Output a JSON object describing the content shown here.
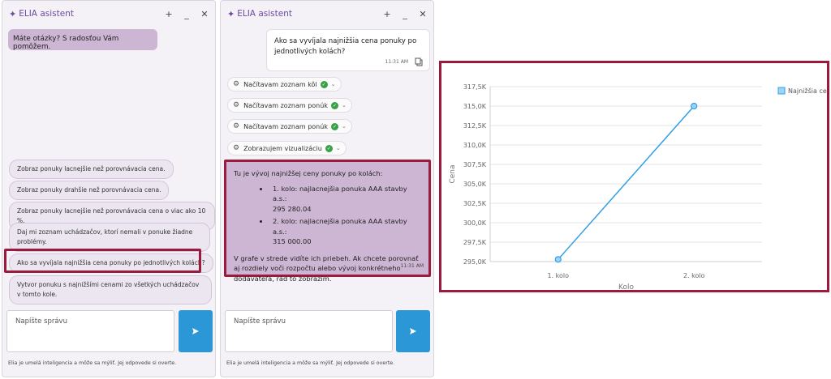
{
  "panel_left": {
    "title": "ELIA asistent",
    "controls": {
      "add": "+",
      "minimize": "_",
      "close": "✕"
    },
    "greeting": "Máte otázky? S radosťou Vám pomôžem.",
    "suggestions": [
      "Zobraz ponuky lacnejšie než porovnávacia cena.",
      "Zobraz ponuky drahšie než porovnávacia cena.",
      "Zobraz ponuky lacnejšie než porovnávacia cena o viac ako 10 %.",
      "Daj mi zoznam uchádzačov, ktorí nemali v ponuke žiadne problémy.",
      "Ako sa vyvíjala najnižšia cena ponuky po jednotlivých kolách?",
      "Vytvor ponuku s najnižšími cenami zo všetkých uchádzačov v tomto kole."
    ],
    "input_placeholder": "Napíšte správu",
    "disclaimer": "Elia je umelá inteligencia a môže sa mýliť. Jej odpovede si overte."
  },
  "panel_right": {
    "title": "ELIA asistent",
    "controls": {
      "add": "+",
      "minimize": "_",
      "close": "✕"
    },
    "user_message": "Ako sa vyvíjala najnižšia cena ponuky po jednotlivých kolách?",
    "user_time": "11:31 AM",
    "steps": [
      "Načítavam zoznam kôl",
      "Načítavam zoznam ponúk",
      "Načítavam zoznam ponúk",
      "Zobrazujem vizualizáciu"
    ],
    "answer": {
      "intro": "Tu je vývoj najnižšej ceny ponuky po kolách:",
      "items": [
        {
          "l1": "1. kolo: najlacnejšia ponuka AAA stavby a.s.:",
          "l2": "295 280.04"
        },
        {
          "l1": "2. kolo: najlacnejšia ponuka AAA stavby a.s.:",
          "l2": "315 000.00"
        }
      ],
      "outro": "V grafe v strede vidíte ich priebeh. Ak chcete porovnať aj rozdiely voči rozpočtu alebo vývoj konkrétneho dodávateľa, rád to zobrazím.",
      "time": "11:31 AM"
    },
    "input_placeholder": "Napíšte správu",
    "disclaimer": "Elia je umelá inteligencia a môže sa mýliť. Jej odpovede si overte."
  },
  "colors": {
    "accent_purple": "#6b4aa0",
    "bubble_purple": "#cdb6d3",
    "highlight": "#9a1b3e",
    "send_button": "#2b97d6",
    "series_line": "#2f9fe6"
  },
  "icons": {
    "logo": "sparkle-icon",
    "send": "send-icon",
    "copy": "copy-icon",
    "gear": "gear-icon",
    "check": "check-icon",
    "chevron": "chevron-down-icon"
  },
  "chart_data": {
    "type": "line",
    "categories": [
      "1. kolo",
      "2. kolo"
    ],
    "series": [
      {
        "name": "Najnižšia cena",
        "values": [
          295280.04,
          315000.0
        ]
      }
    ],
    "ylabel": "Cena",
    "xlabel": "Kolo",
    "ylim": [
      295000,
      317500
    ],
    "yticks": [
      295000,
      297500,
      300000,
      302500,
      305000,
      307500,
      310000,
      312500,
      315000,
      317500
    ],
    "ytick_labels": [
      "295,0K",
      "297,5K",
      "300,0K",
      "302,5K",
      "305,0K",
      "307,5K",
      "310,0K",
      "312,5K",
      "315,0K",
      "317,5K"
    ],
    "grid": true,
    "legend": "top-right"
  }
}
